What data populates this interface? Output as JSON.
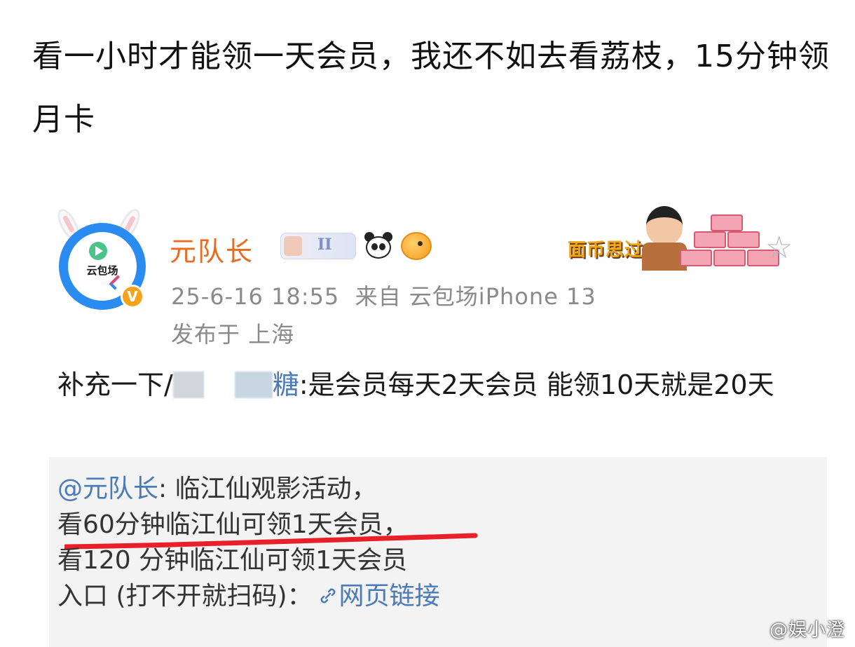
{
  "post": {
    "caption": "看一小时才能领一天会员，我还不如去看荔枝，15分钟领月卡"
  },
  "screenshot": {
    "author": {
      "name": "元队长",
      "avatar_text": "云包场",
      "verified_badge": "V",
      "level_badge": "II"
    },
    "sticker_text": "面币思过",
    "meta": {
      "timestamp": "25-6-16 18:55",
      "source": "来自 云包场iPhone 13",
      "location": "发布于 上海"
    },
    "body": {
      "prefix": "补充一下/",
      "mention_tail": "糖",
      "text": ":是会员每天2天会员 能领10天就是20天"
    },
    "quote": {
      "mention": "@元队长",
      "line1": ": 临江仙观影活动，",
      "line2": "看60分钟临江仙可领1天会员，",
      "line3": "看120 分钟临江仙可领1天会员",
      "line4_prefix": "入口 (打不开就扫码)：",
      "link_label": "网页链接"
    },
    "colors": {
      "username": "#e86b1f",
      "link": "#4a7bb8",
      "underline": "#e8202a",
      "quote_bg": "#f3f3f3"
    }
  },
  "watermark": "@娱小澄"
}
